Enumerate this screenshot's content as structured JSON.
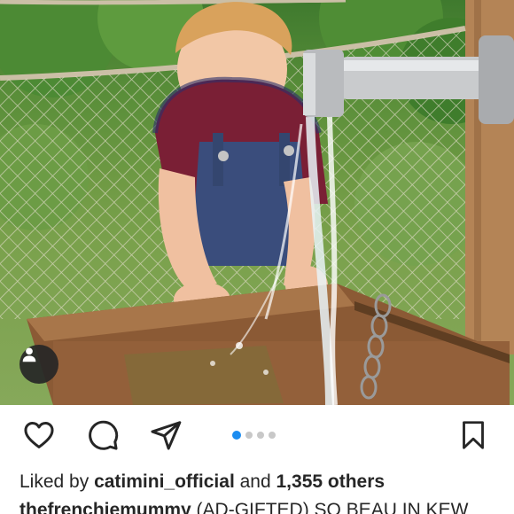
{
  "post": {
    "image_alt": "",
    "carousel": {
      "count": 4,
      "active_index": 0
    }
  },
  "colors": {
    "accent": "#1b8cf0",
    "text": "#262626",
    "dot_inactive": "#c8c8c8"
  },
  "actions": {
    "like_icon": "heart-icon",
    "comment_icon": "comment-icon",
    "share_icon": "paper-plane-icon",
    "save_icon": "bookmark-icon",
    "tagged_icon": "person-icon"
  },
  "likes": {
    "prefix": "Liked by ",
    "user": "catimini_official",
    "middle": " and ",
    "count": "1,355 others"
  },
  "caption": {
    "username": "thefrenchiemummy",
    "text": " (AD-GIFTED) SO BEAU IN KEW"
  }
}
